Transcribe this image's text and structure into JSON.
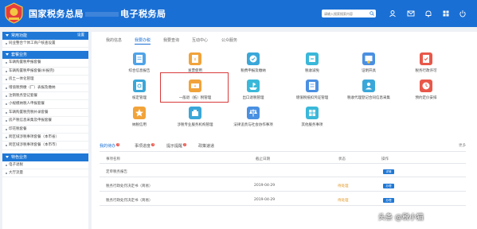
{
  "header": {
    "title": "国家税务总局",
    "title_suffix": "电子税务局",
    "search_placeholder": "请输入搜索搜索内容"
  },
  "sidebar": {
    "section1": {
      "title": "常用功能",
      "right": "设置"
    },
    "section1_items": [
      "同业整合个体工商户核查设置"
    ],
    "section2": {
      "title": "套餐业务"
    },
    "section2_items": [
      "车辆购置税申报套餐",
      "车辆购置税申报套餐(补报完)",
      "房土一体化管理",
      "增值税预缴（厂）表报及缴纳",
      "注销税务登记套餐",
      "小规模纳税人申报套餐",
      "车辆购置税完税补录套餐",
      "房产税信息采集及申报套餐",
      "印花税套餐",
      "跨区域涉税事项套餐（本市省）",
      "跨区域涉税事项套餐（本市市）"
    ],
    "section3": {
      "title": "特色业务"
    },
    "section3_items": [
      "电子退税",
      "大厅流量"
    ]
  },
  "main": {
    "tabs": [
      "我的信息",
      "我要办税",
      "我要查询",
      "互动中心",
      "公众服务"
    ],
    "functions": [
      {
        "label": "综合信息报告",
        "icon": "report-icon"
      },
      {
        "label": "发票使用",
        "icon": "invoice-icon"
      },
      {
        "label": "税费申报及缴纳",
        "icon": "tax-declare-icon"
      },
      {
        "label": "税收减免",
        "icon": "tax-reduction-icon"
      },
      {
        "label": "证明开具",
        "icon": "certificate-icon"
      },
      {
        "label": "税务行政许可",
        "icon": "license-icon"
      },
      {
        "label": "核定管理",
        "icon": "approval-icon"
      },
      {
        "label": "一般退（抵）税管理",
        "icon": "refund-icon"
      },
      {
        "label": "出口退税管理",
        "icon": "export-refund-icon"
      },
      {
        "label": "增值税抵扣凭证管理",
        "icon": "vat-deduction-icon"
      },
      {
        "label": "税收代理登记合同信息采集",
        "icon": "agent-icon"
      },
      {
        "label": "预约定价安排",
        "icon": "pricing-icon"
      },
      {
        "label": "纳税信用",
        "icon": "credit-icon"
      },
      {
        "label": "涉税专业服务机构管理",
        "icon": "service-agency-icon"
      },
      {
        "label": "法律追责与社会协作事项",
        "icon": "legal-icon"
      },
      {
        "label": "其他服务事项",
        "icon": "other-services-icon"
      }
    ],
    "notice_tabs": [
      {
        "label": "我的待办",
        "badge": "3"
      },
      {
        "label": "事项进度",
        "badge": "3"
      },
      {
        "label": "提示提醒",
        "badge": "2"
      },
      {
        "label": "政策速递",
        "badge": ""
      }
    ],
    "more_label": "更多",
    "table": {
      "headers": [
        "事项名称",
        "截止日期",
        "状态",
        "操作"
      ],
      "rows": [
        {
          "name": "定单税务报告",
          "date": "",
          "status": "",
          "action": "详情"
        },
        {
          "name": "税务行政处罚决定书（简易）",
          "date": "2019-04-29",
          "status": "待处理",
          "action": "办理"
        },
        {
          "name": "税务行政处罚决定书（简易）",
          "date": "2019-04-29",
          "status": "待处理",
          "action": "办理"
        }
      ]
    }
  },
  "watermark": "头条 @税小猫",
  "colors": {
    "brand": "#1a6fd4",
    "highlight": "#d93a3a",
    "pending": "#e39b2b"
  }
}
